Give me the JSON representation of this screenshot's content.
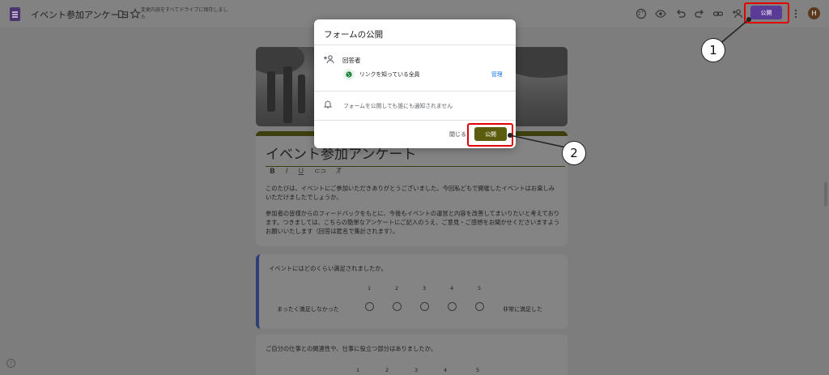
{
  "topbar": {
    "doc_title": "イベント参加アンケート",
    "save_note": "変更内容をすべてドライブに保存しました",
    "publish_label": "公開",
    "avatar_initial": "H"
  },
  "form": {
    "title": "イベント参加アンケート",
    "format_buttons": [
      "B",
      "I",
      "U",
      "⊂⊃",
      "T̸"
    ],
    "description": [
      "このたびは、イベントにご参加いただきありがとうございました。今回私どもで開催したイベントはお楽しみいただけましたでしょうか。",
      "参加者の皆様からのフィードバックをもとに、今後もイベントの運営と内容を改善してまいりたいと考えております。つきましては、こちらの簡単なアンケートにご記入のうえ、ご意見・ご感想をお聞かせくださいますようお願いいたします（回答は匿名で集計されます）。"
    ],
    "q1": {
      "text": "イベントにはどのくらい満足されましたか。",
      "scale": [
        "1",
        "2",
        "3",
        "4",
        "5"
      ],
      "low_label": "まったく満足しなかった",
      "high_label": "非常に満足した"
    },
    "q2": {
      "text": "ご自分の仕事との関連性や、仕事に役立つ部分はありましたか。",
      "scale": [
        "1",
        "2",
        "3",
        "4",
        "5"
      ]
    }
  },
  "modal": {
    "title": "フォームの公開",
    "respondents_label": "回答者",
    "link_scope": "リンクを知っている全員",
    "manage_label": "管理",
    "notify_text": "フォームを公開しても誰にも通知されません",
    "close_label": "閉じる",
    "publish_label": "公開"
  },
  "annotations": {
    "callout1": "1",
    "callout2": "2",
    "highlight_color": "#e00000"
  },
  "colors": {
    "accent_purple": "#5a3c96",
    "publish_olive": "#5c5c0f",
    "link_blue": "#1a73e8"
  }
}
